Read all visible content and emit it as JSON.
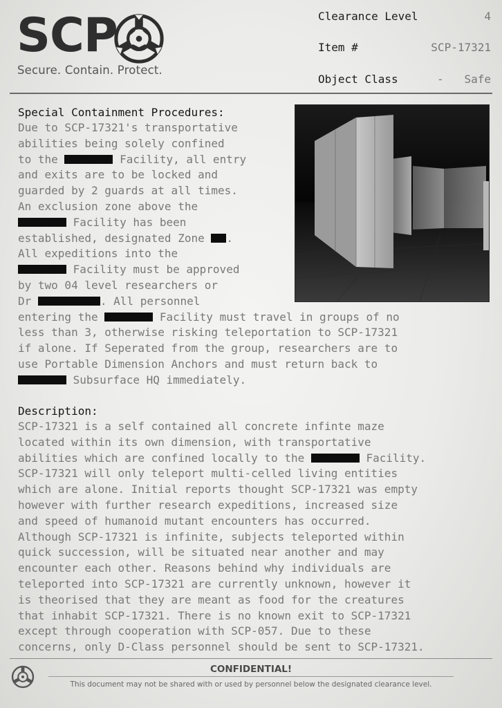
{
  "header": {
    "logo_text": "SCP",
    "tagline": "Secure. Contain. Protect.",
    "clearance_label": "Clearance Level",
    "clearance_value": "4",
    "item_label": "Item #",
    "item_value": "SCP-17321",
    "class_label": "Object Class",
    "class_separator": "-",
    "class_value": "Safe"
  },
  "procedures": {
    "heading": "Special Containment Procedures:",
    "lines": [
      [
        "Due to SCP-17321's transportative"
      ],
      [
        "abilities being solely confined"
      ],
      [
        "to the ",
        "█",
        " Facility, all entry"
      ],
      [
        "and exits are to be locked and"
      ],
      [
        "guarded by 2 guards at all times."
      ],
      [
        "An exclusion zone above the"
      ],
      [
        "█",
        " Facility has been"
      ],
      [
        "established, designated Zone ",
        "█",
        "."
      ],
      [
        "All expeditions into the"
      ],
      [
        "█",
        " Facility must be approved"
      ],
      [
        "by two 04 level researchers or"
      ],
      [
        "Dr ",
        "█",
        ". All personnel"
      ],
      [
        "entering the ",
        "█",
        " Facility must travel in groups of no"
      ],
      [
        "less than 3, otherwise risking teleportation to SCP-17321"
      ],
      [
        "if alone. If Seperated from the group, researchers are to"
      ],
      [
        "use Portable Dimension Anchors and must return back to"
      ],
      [
        "█",
        " Subsurface HQ immediately."
      ]
    ]
  },
  "description": {
    "heading": "Description:",
    "lines": [
      [
        "SCP-17321 is a self contained all concrete infinte maze"
      ],
      [
        "located within its own dimension, with transportative"
      ],
      [
        "abilities which are confined locally to the ",
        "█",
        " Facility."
      ],
      [
        "SCP-17321 will only teleport multi-celled living entities"
      ],
      [
        "which are alone. Initial reports thought SCP-17321 was empty"
      ],
      [
        "however with further research expeditions, increased size"
      ],
      [
        "and speed of humanoid mutant encounters has occurred."
      ],
      [
        "Although SCP-17321 is infinite, subjects teleported within"
      ],
      [
        "quick succession, will be situated near another and may"
      ],
      [
        "encounter each other. Reasons behind why individuals are"
      ],
      [
        "teleported into SCP-17321 are currently unknown, however it"
      ],
      [
        "is theorised that they are meant as food for the creatures"
      ],
      [
        "that inhabit SCP-17321. There is no known exit to SCP-17321"
      ],
      [
        "except through cooperation with SCP-057. Due to these"
      ],
      [
        "concerns, only D-Class personnel should be sent to SCP-17321."
      ]
    ]
  },
  "footer": {
    "confidential": "CONFIDENTIAL!",
    "note": "This document may not be shared with or used by personnel below the designated clearance level."
  },
  "icons": {
    "logo": "scp-emblem-icon",
    "footer": "scp-emblem-small-icon"
  }
}
